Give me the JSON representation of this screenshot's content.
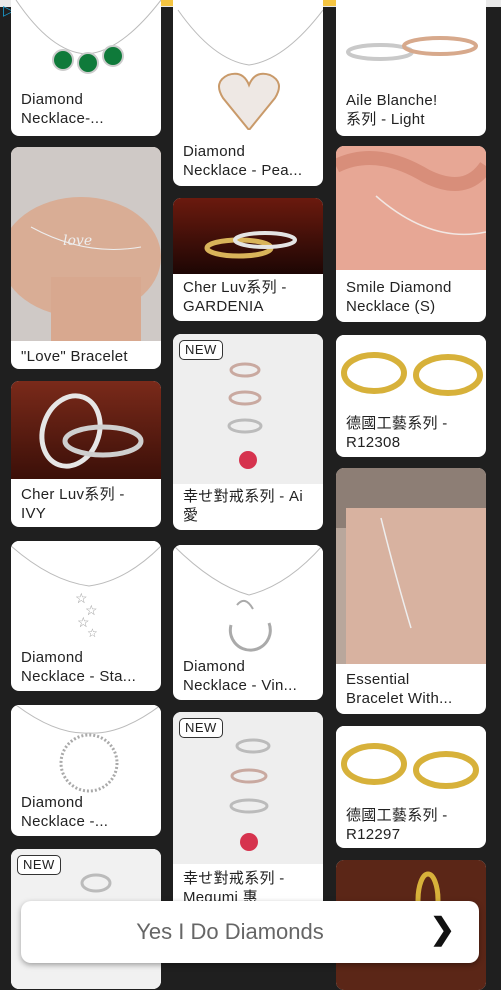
{
  "banner": {
    "title": "Yes I Do Diamonds"
  },
  "badge_new": "NEW",
  "cards": [
    {
      "label": "Diamond\nNecklace-..."
    },
    {
      "label": "\"Love\" Bracelet"
    },
    {
      "label": "Cher Luv系列 -\nIVY"
    },
    {
      "label": "Diamond\nNecklace - Sta..."
    },
    {
      "label": "Diamond\nNecklace -..."
    },
    {
      "label": "Diamond\nNecklace - Pea..."
    },
    {
      "label": "Cher Luv系列 -\nGARDENIA"
    },
    {
      "label": "幸せ對戒系列 - Ai\n愛"
    },
    {
      "label": "Diamond\nNecklace - Vin..."
    },
    {
      "label": "幸せ對戒系列 -\nMegumi 惠"
    },
    {
      "label": "Aile Blanche!\n系列 - Light"
    },
    {
      "label": "Smile Diamond\nNecklace (S)"
    },
    {
      "label": "德國工藝系列 -\nR12308"
    },
    {
      "label": "Essential\nBracelet With..."
    },
    {
      "label": "德國工藝系列 -\nR12297"
    }
  ]
}
